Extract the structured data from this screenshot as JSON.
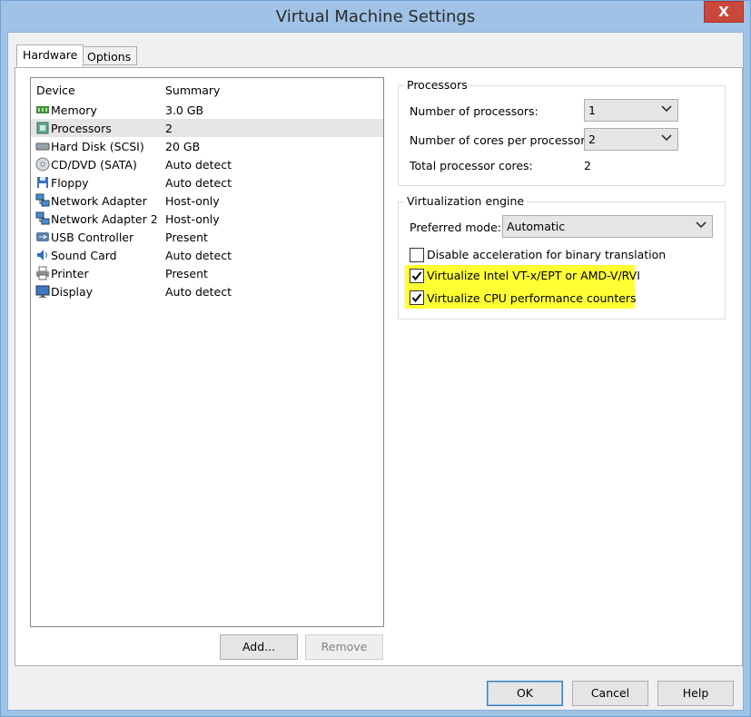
{
  "window": {
    "title": "Virtual Machine Settings",
    "close_glyph": "X"
  },
  "tabs": [
    {
      "label": "Hardware",
      "active": true
    },
    {
      "label": "Options",
      "active": false
    }
  ],
  "device_list": {
    "columns": [
      "Device",
      "Summary"
    ],
    "rows": [
      {
        "device": "Memory",
        "summary": "3.0 GB",
        "icon": "memory-icon"
      },
      {
        "device": "Processors",
        "summary": "2",
        "icon": "processor-icon",
        "selected": true
      },
      {
        "device": "Hard Disk (SCSI)",
        "summary": "20 GB",
        "icon": "hard-disk-icon"
      },
      {
        "device": "CD/DVD (SATA)",
        "summary": "Auto detect",
        "icon": "cd-dvd-icon"
      },
      {
        "device": "Floppy",
        "summary": "Auto detect",
        "icon": "floppy-icon"
      },
      {
        "device": "Network Adapter",
        "summary": "Host-only",
        "icon": "network-adapter-icon"
      },
      {
        "device": "Network Adapter 2",
        "summary": "Host-only",
        "icon": "network-adapter-icon"
      },
      {
        "device": "USB Controller",
        "summary": "Present",
        "icon": "usb-icon"
      },
      {
        "device": "Sound Card",
        "summary": "Auto detect",
        "icon": "sound-card-icon"
      },
      {
        "device": "Printer",
        "summary": "Present",
        "icon": "printer-icon"
      },
      {
        "device": "Display",
        "summary": "Auto detect",
        "icon": "display-icon"
      }
    ],
    "add_label": "Add...",
    "remove_label": "Remove"
  },
  "processors": {
    "title": "Processors",
    "num_processors_label": "Number of processors:",
    "num_processors_value": "1",
    "cores_label": "Number of cores per processor:",
    "cores_value": "2",
    "total_label": "Total processor cores:",
    "total_value": "2"
  },
  "virtualization": {
    "title": "Virtualization engine",
    "mode_label": "Preferred mode:",
    "mode_value": "Automatic",
    "options": [
      {
        "label": "Disable acceleration for binary translation",
        "checked": false,
        "highlighted": false
      },
      {
        "label": "Virtualize Intel VT-x/EPT or AMD-V/RVI",
        "checked": true,
        "highlighted": true
      },
      {
        "label": "Virtualize CPU performance counters",
        "checked": true,
        "highlighted": true
      }
    ],
    "highlight_color": "#ffff33"
  },
  "footer": {
    "ok_label": "OK",
    "cancel_label": "Cancel",
    "help_label": "Help"
  }
}
